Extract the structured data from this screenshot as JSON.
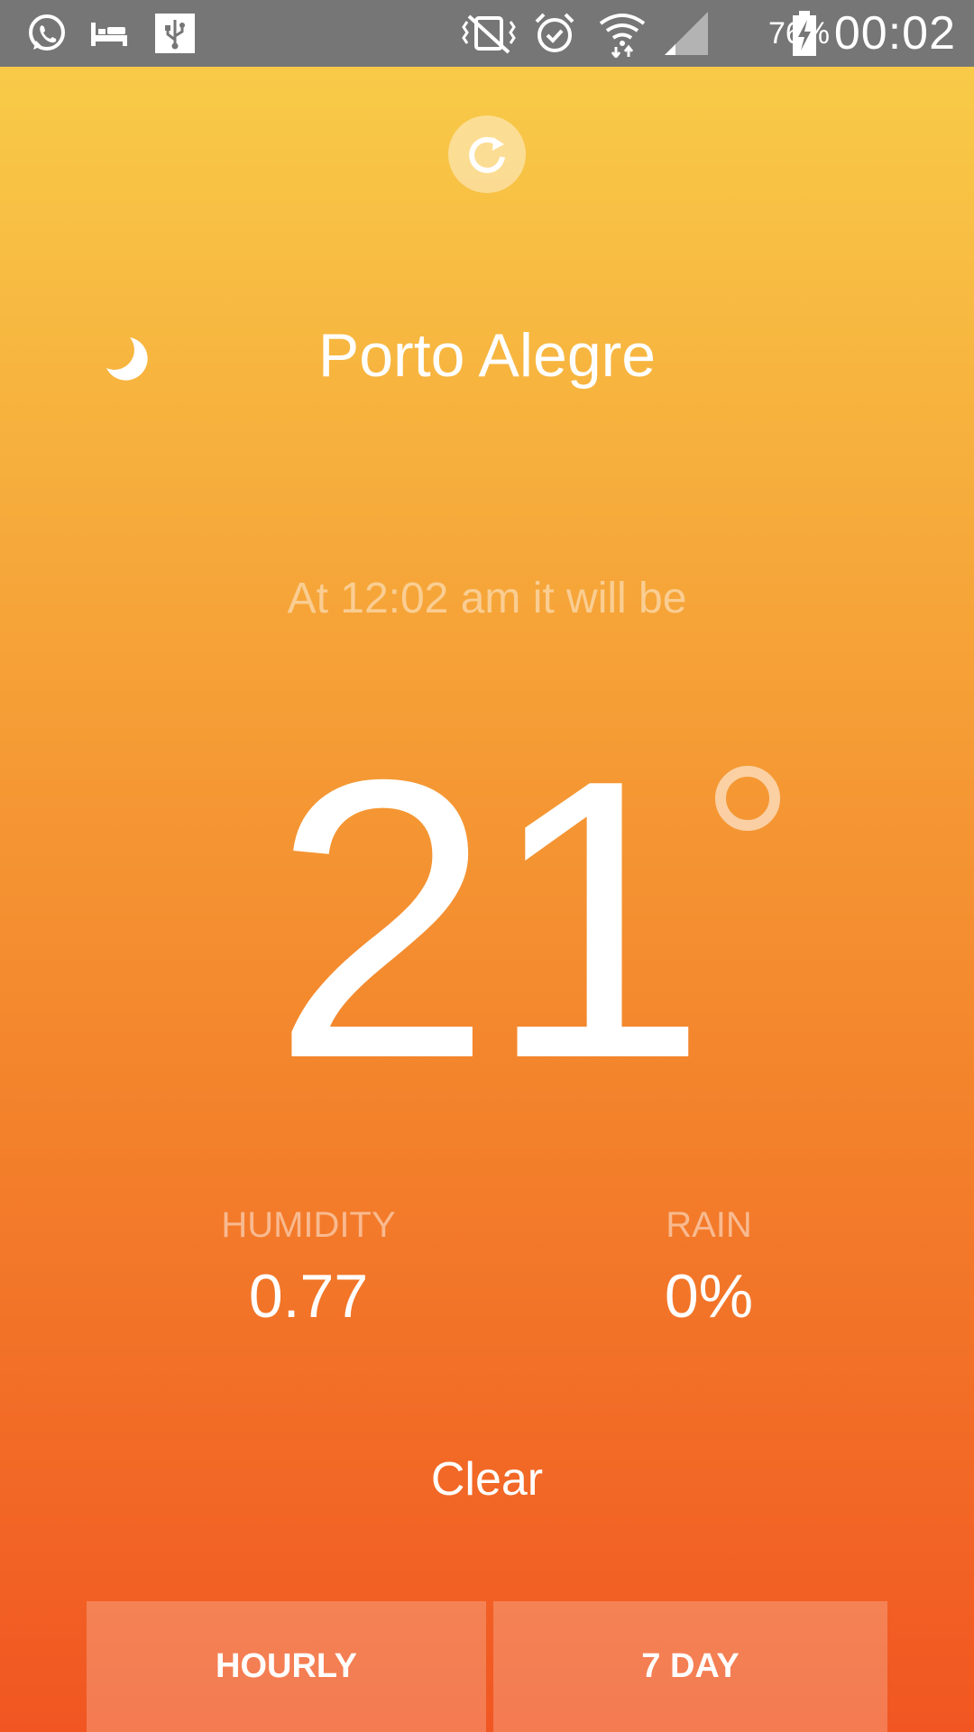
{
  "status_bar": {
    "battery_percent": "76%",
    "time": "00:02",
    "icons": [
      "whatsapp-icon",
      "sleep-icon",
      "usb-icon",
      "vibrate-off-icon",
      "alarm-icon",
      "wifi-icon",
      "signal-icon",
      "battery-charging-icon"
    ]
  },
  "weather": {
    "city": "Porto Alegre",
    "forecast_text": "At 12:02 am it will be",
    "temperature": "21",
    "humidity_label": "HUMIDITY",
    "humidity_value": "0.77",
    "rain_label": "RAIN",
    "rain_value": "0%",
    "summary": "Clear",
    "condition_icon": "moon-icon"
  },
  "tabs": {
    "hourly": "HOURLY",
    "seven_day": "7 DAY"
  },
  "colors": {
    "gradient_top": "#F9CF4A",
    "gradient_bottom": "#F15622",
    "status_bar": "#767676"
  }
}
